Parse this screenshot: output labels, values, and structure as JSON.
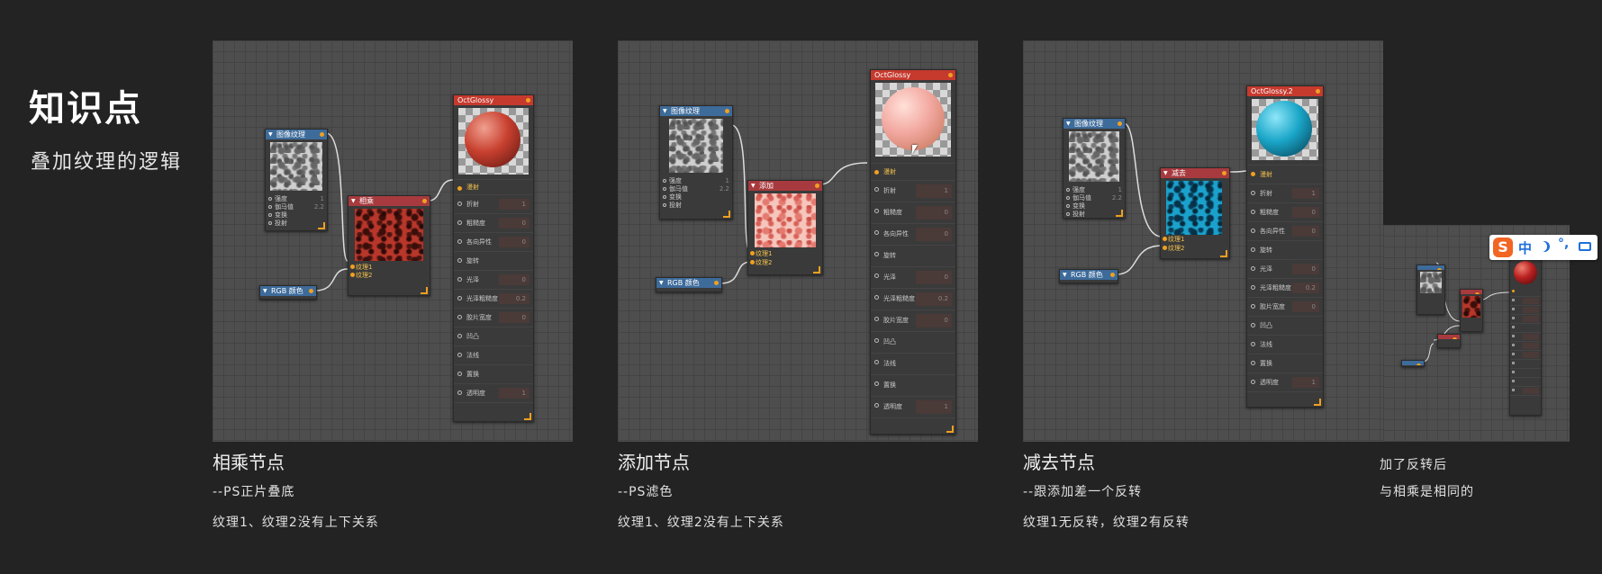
{
  "sidebar": {
    "title": "知识点",
    "subtitle": "叠加纹理的逻辑"
  },
  "panels": [
    {
      "caption": "相乘节点",
      "sub1": "--PS正片叠底",
      "sub2": "纹理1、纹理2没有上下关系",
      "image_node": {
        "title": "图像纹理",
        "params": [
          "强度",
          "伽马值",
          "变换",
          "投射"
        ],
        "strength": "1",
        "gamma": "2.2"
      },
      "op_node": {
        "title": "相乘",
        "port1": "纹理1",
        "port2": "纹理2"
      },
      "rgb_node": {
        "title": "RGB 颜色"
      },
      "material": {
        "title": "OctGlossy",
        "diffuse": "漫射",
        "rows": [
          "折射",
          "粗糙度",
          "各向异性",
          "旋转",
          "光泽",
          "光泽粗糙度",
          "胶片宽度",
          "凹凸",
          "法线",
          "置换",
          "透明度"
        ],
        "values": [
          "1",
          "0",
          "0",
          "",
          "0",
          "0.2",
          "0",
          "",
          "",
          "",
          "1"
        ]
      }
    },
    {
      "caption": "添加节点",
      "sub1": "--PS滤色",
      "sub2": "纹理1、纹理2没有上下关系",
      "image_node": {
        "title": "图像纹理",
        "params": [
          "强度",
          "伽马值",
          "变换",
          "投射"
        ],
        "strength": "1",
        "gamma": "2.2"
      },
      "op_node": {
        "title": "添加",
        "port1": "纹理1",
        "port2": "纹理2"
      },
      "rgb_node": {
        "title": "RGB 颜色"
      },
      "material": {
        "title": "OctGlossy",
        "diffuse": "漫射",
        "rows": [
          "折射",
          "粗糙度",
          "各向异性",
          "旋转",
          "光泽",
          "光泽粗糙度",
          "胶片宽度",
          "凹凸",
          "法线",
          "置换",
          "透明度"
        ],
        "values": [
          "1",
          "0",
          "0",
          "",
          "0",
          "0.2",
          "0",
          "",
          "",
          "",
          "1"
        ]
      }
    },
    {
      "caption": "减去节点",
      "sub1": "--跟添加差一个反转",
      "sub2": "纹理1无反转，纹理2有反转",
      "image_node": {
        "title": "图像纹理",
        "params": [
          "强度",
          "伽马值",
          "变换",
          "投射"
        ],
        "strength": "1",
        "gamma": "2.2"
      },
      "op_node": {
        "title": "减去",
        "port1": "纹理1",
        "port2": "纹理2"
      },
      "rgb_node": {
        "title": "RGB 颜色"
      },
      "material": {
        "title": "OctGlossy.2",
        "diffuse": "漫射",
        "rows": [
          "折射",
          "粗糙度",
          "各向异性",
          "旋转",
          "光泽",
          "光泽粗糙度",
          "胶片宽度",
          "凹凸",
          "法线",
          "置换",
          "透明度"
        ],
        "values": [
          "1",
          "0",
          "0",
          "",
          "0",
          "0.2",
          "0",
          "",
          "",
          "",
          "1"
        ]
      }
    }
  ],
  "fourth": {
    "line1": "加了反转后",
    "line2": "与相乘是相同的"
  },
  "ime": {
    "label": "中",
    "logo": "S"
  },
  "colors": {
    "bg": "#232323",
    "grid": "#4e4e4e",
    "accent": "#f0a020",
    "mat_header": "#c63a2e",
    "tex_header": "#3d6b9a",
    "op_header": "#a73a3e"
  }
}
